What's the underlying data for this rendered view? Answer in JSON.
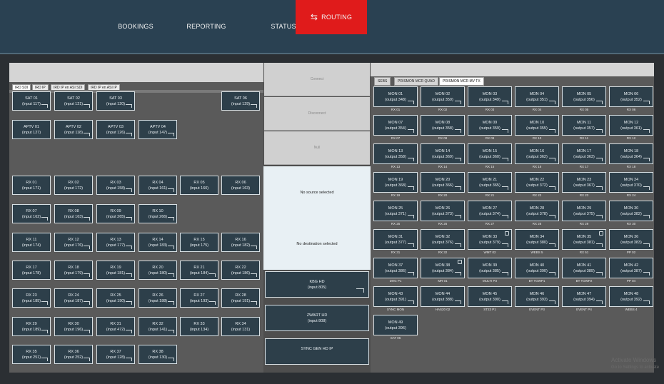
{
  "nav": {
    "bookings": "BOOKINGS",
    "reporting": "REPORTING",
    "status": "STATUS",
    "routing_icon": "swap-arrows-icon",
    "routing": "ROUTING",
    "routing_color": "#e01b1b"
  },
  "left_tabs": [
    "IRD SDI",
    "IRD IP",
    "IRD IP en ASI SDI",
    "IRD IP en ASI IP"
  ],
  "sources": [
    {
      "name": "SAT 01",
      "input": "(input 117)"
    },
    {
      "name": "SAT 02",
      "input": "(input 121)"
    },
    {
      "name": "SAT 03",
      "input": "(input 120)"
    },
    {
      "name": "SAT 06",
      "input": "(input 129)"
    },
    {
      "name": "APTV 01",
      "input": "(input 127)"
    },
    {
      "name": "APTV 02",
      "input": "(input 118)"
    },
    {
      "name": "APTV 03",
      "input": "(input 126)"
    },
    {
      "name": "APTV 04",
      "input": "(input 147)"
    },
    {
      "name": "RX 01",
      "input": "(input 171)"
    },
    {
      "name": "RX 02",
      "input": "(input 172)"
    },
    {
      "name": "RX 03",
      "input": "(input 158)"
    },
    {
      "name": "RX 04",
      "input": "(input 161)"
    },
    {
      "name": "RX 05",
      "input": "(input 160)"
    },
    {
      "name": "RX 06",
      "input": "(input 163)"
    },
    {
      "name": "RX 07",
      "input": "(input 162)"
    },
    {
      "name": "RX 08",
      "input": "(input 163)"
    },
    {
      "name": "RX 09",
      "input": "(input 265)"
    },
    {
      "name": "RX 10",
      "input": "(input 266)"
    },
    {
      "name": "RX 11",
      "input": "(input 174)"
    },
    {
      "name": "RX 12",
      "input": "(input 176)"
    },
    {
      "name": "RX 13",
      "input": "(input 177)"
    },
    {
      "name": "RX 14",
      "input": "(input 183)"
    },
    {
      "name": "RX 15",
      "input": "(input 175)"
    },
    {
      "name": "RX 16",
      "input": "(input 182)"
    },
    {
      "name": "RX 17",
      "input": "(input 178)"
    },
    {
      "name": "RX 18",
      "input": "(input 179)"
    },
    {
      "name": "RX 19",
      "input": "(input 181)"
    },
    {
      "name": "RX 20",
      "input": "(input 180)"
    },
    {
      "name": "RX 21",
      "input": "(input 184)"
    },
    {
      "name": "RX 22",
      "input": "(input 186)"
    },
    {
      "name": "RX 23",
      "input": "(input 185)"
    },
    {
      "name": "RX 24",
      "input": "(input 187)"
    },
    {
      "name": "RX 25",
      "input": "(input 190)"
    },
    {
      "name": "RX 26",
      "input": "(input 188)"
    },
    {
      "name": "RX 27",
      "input": "(input 193)"
    },
    {
      "name": "RX 28",
      "input": "(input 191)"
    },
    {
      "name": "RX 29",
      "input": "(input 189)"
    },
    {
      "name": "RX 30",
      "input": "(input 196)"
    },
    {
      "name": "RX 31",
      "input": "(input 472)"
    },
    {
      "name": "RX 32",
      "input": "(input 141)"
    },
    {
      "name": "RX 33",
      "input": "(input 134)"
    },
    {
      "name": "RX 34",
      "input": "(input 131)"
    },
    {
      "name": "RX 35",
      "input": "(input 251)"
    },
    {
      "name": "RX 36",
      "input": "(input 252)"
    },
    {
      "name": "RX 37",
      "input": "(input 128)"
    },
    {
      "name": "RX 38",
      "input": "(input 130)"
    }
  ],
  "middle": {
    "connect": "Connect",
    "disconnect": "Disconnect",
    "null": "Null",
    "no_source": "No source selected",
    "no_destination": "No destination selected",
    "devices": [
      {
        "name": "KBG HD",
        "input": "(input 805)"
      },
      {
        "name": "ZWART HD",
        "input": "(input 808)"
      },
      {
        "name": "SYNC GEN HD IP",
        "input": ""
      }
    ]
  },
  "right_tabs": [
    "SEBS",
    "PRISMON MCR QUAD",
    "PRISMON MCR MV TX"
  ],
  "destinations": [
    {
      "name": "MON 01",
      "output": "(output 348)",
      "src": "RX 01"
    },
    {
      "name": "MON 02",
      "output": "(output 350)",
      "src": "RX 02"
    },
    {
      "name": "MON 03",
      "output": "(output 349)",
      "src": "RX 03"
    },
    {
      "name": "MON 04",
      "output": "(output 351)",
      "src": "RX 04"
    },
    {
      "name": "MON 05",
      "output": "(output 356)",
      "src": "RX 05"
    },
    {
      "name": "MON 06",
      "output": "(output 352)",
      "src": "RX 06"
    },
    {
      "name": "MON 07",
      "output": "(output 354)",
      "src": "RX 07"
    },
    {
      "name": "MON 08",
      "output": "(output 358)",
      "src": "RX 08"
    },
    {
      "name": "MON 09",
      "output": "(output 359)",
      "src": "RX 09"
    },
    {
      "name": "MON 10",
      "output": "(output 355)",
      "src": "RX 10"
    },
    {
      "name": "MON 11",
      "output": "(output 357)",
      "src": "RX 11"
    },
    {
      "name": "MON 12",
      "output": "(output 361)",
      "src": "RX 12"
    },
    {
      "name": "MON 13",
      "output": "(output 358)",
      "src": "RX 13"
    },
    {
      "name": "MON 14",
      "output": "(output 369)",
      "src": "RX 14"
    },
    {
      "name": "MON 15",
      "output": "(output 360)",
      "src": "RX 15"
    },
    {
      "name": "MON 16",
      "output": "(output 362)",
      "src": "RX 16"
    },
    {
      "name": "MON 17",
      "output": "(output 363)",
      "src": "RX 17"
    },
    {
      "name": "MON 18",
      "output": "(output 364)",
      "src": "RX 18"
    },
    {
      "name": "MON 19",
      "output": "(output 368)",
      "src": "RX 19"
    },
    {
      "name": "MON 20",
      "output": "(output 366)",
      "src": "RX 20"
    },
    {
      "name": "MON 21",
      "output": "(output 365)",
      "src": "RX 21"
    },
    {
      "name": "MON 22",
      "output": "(output 372)",
      "src": "RX 22"
    },
    {
      "name": "MON 23",
      "output": "(output 367)",
      "src": "RX 23"
    },
    {
      "name": "MON 24",
      "output": "(output 370)",
      "src": "RX 24"
    },
    {
      "name": "MON 25",
      "output": "(output 371)",
      "src": "RX 25"
    },
    {
      "name": "MON 26",
      "output": "(output 373)",
      "src": "RX 26"
    },
    {
      "name": "MON 27",
      "output": "(output 374)",
      "src": "RX 27"
    },
    {
      "name": "MON 28",
      "output": "(output 378)",
      "src": "RX 28"
    },
    {
      "name": "MON 29",
      "output": "(output 375)",
      "src": "RX 29"
    },
    {
      "name": "MON 30",
      "output": "(output 382)",
      "src": "RX 30"
    },
    {
      "name": "MON 31",
      "output": "(output 377)",
      "src": "RX 31"
    },
    {
      "name": "MON 32",
      "output": "(output 376)",
      "src": "RX 32"
    },
    {
      "name": "MON 33",
      "output": "(output 379)",
      "src": "WMT 02"
    },
    {
      "name": "MON 34",
      "output": "(output 380)",
      "src": "WEBS 5"
    },
    {
      "name": "MON 35",
      "output": "(output 381)",
      "src": "RX 51"
    },
    {
      "name": "MON 36",
      "output": "(output 383)",
      "src": "PP 02"
    },
    {
      "name": "MON 37",
      "output": "(output 386)",
      "src": "DHG P1"
    },
    {
      "name": "MON 38",
      "output": "(output 384)",
      "src": "MR 01"
    },
    {
      "name": "MON 39",
      "output": "(output 385)",
      "src": "MULTI P3"
    },
    {
      "name": "MON 40",
      "output": "(output 390)",
      "src": "BT TOWP1"
    },
    {
      "name": "MON 41",
      "output": "(output 389)",
      "src": "BT TOWP2"
    },
    {
      "name": "MON 42",
      "output": "(output 387)",
      "src": "PP 04"
    },
    {
      "name": "MON 43",
      "output": "(output 391)",
      "src": "SYNC MON"
    },
    {
      "name": "MON 44",
      "output": "(output 388)",
      "src": "HAS20 02"
    },
    {
      "name": "MON 45",
      "output": "(output 390)",
      "src": "ST23 P1"
    },
    {
      "name": "MON 46",
      "output": "(output 393)",
      "src": "EVENT P3"
    },
    {
      "name": "MON 47",
      "output": "(output 394)",
      "src": "EVENT P4"
    },
    {
      "name": "MON 48",
      "output": "(output 392)",
      "src": "WEBS 4"
    },
    {
      "name": "MON 49",
      "output": "(output 396)",
      "src": "SAT 06"
    }
  ],
  "watermark": {
    "line1": "Activate Windows",
    "line2": "Go to Settings to activate"
  }
}
